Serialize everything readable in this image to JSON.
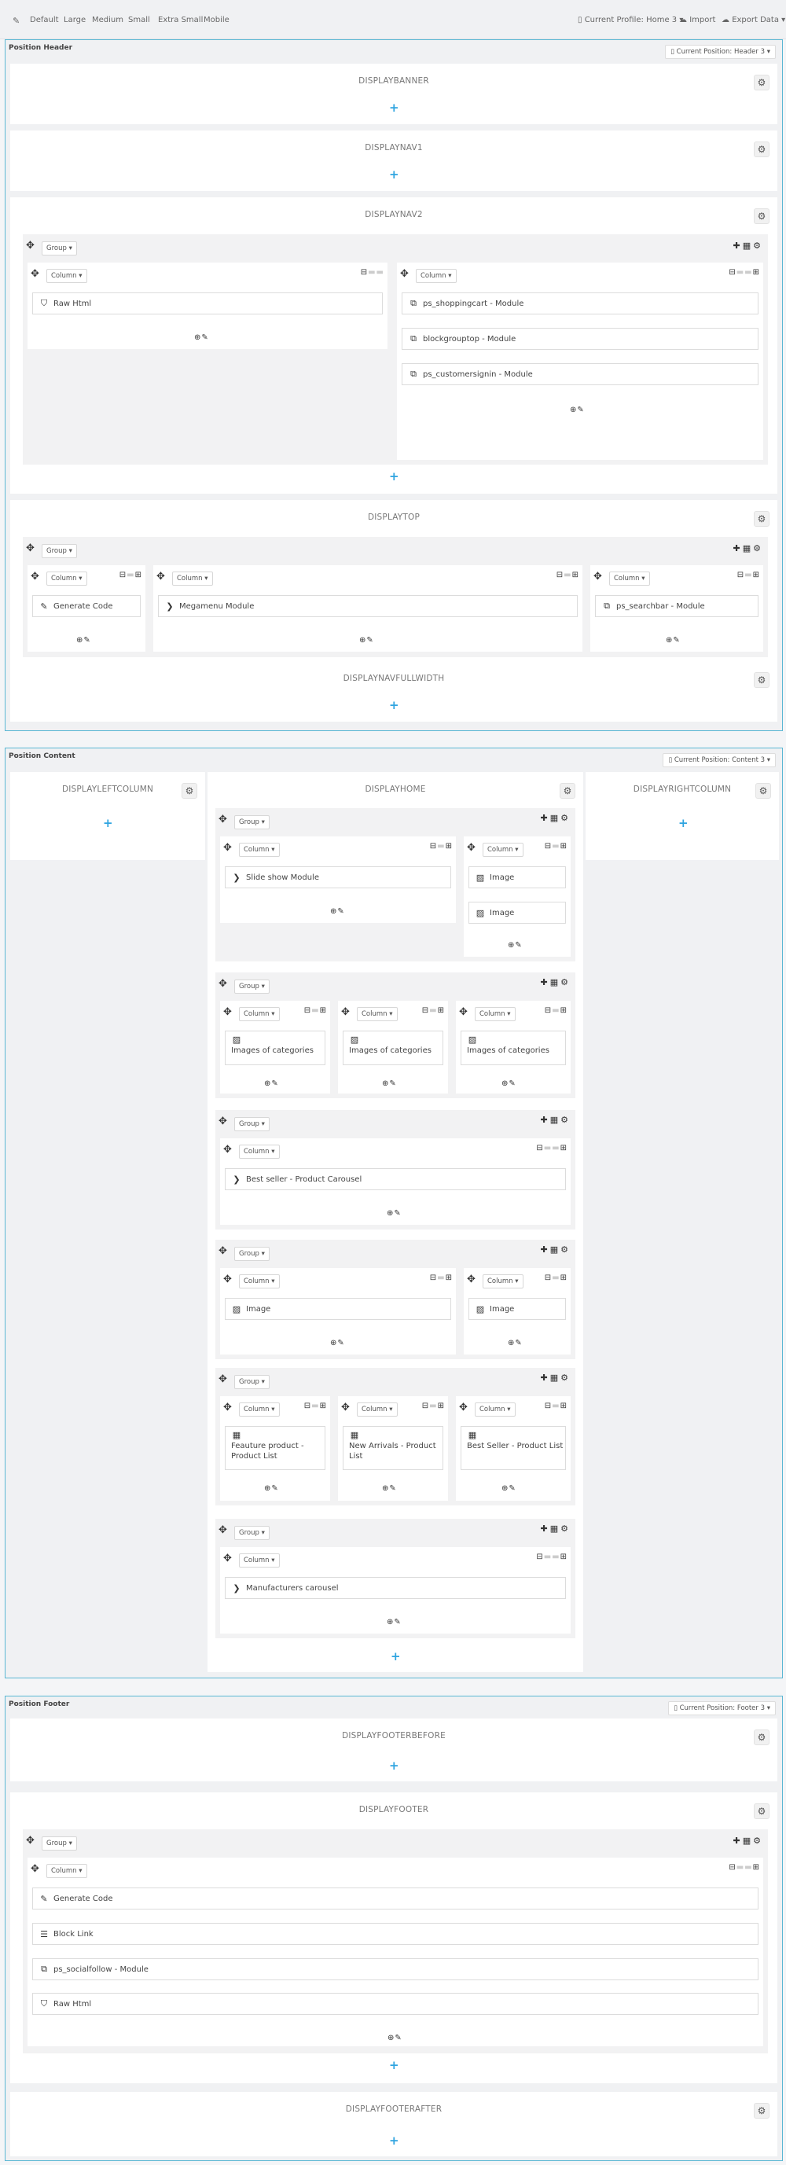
{
  "toolbar": {
    "tool_icon": "wand-icon",
    "devices": [
      "Default",
      "Large",
      "Medium",
      "Small",
      "Extra Small",
      "Mobile"
    ],
    "profile": "Current Profile: Home 3 ▾",
    "import": "Import",
    "export": "Export Data ▾"
  },
  "positions": {
    "header": {
      "title": "Position Header",
      "current": "Current Position: Header 3 ▾"
    },
    "content": {
      "title": "Position Content",
      "current": "Current Position: Content 3 ▾"
    },
    "footer": {
      "title": "Position Footer",
      "current": "Current Position: Footer 3 ▾"
    }
  },
  "hooks": {
    "displaybanner": "DISPLAYBANNER",
    "displaynav1": "DISPLAYNAV1",
    "displaynav2": "DISPLAYNAV2",
    "displaytop": "DISPLAYTOP",
    "displaynavfullwidth": "DISPLAYNAVFULLWIDTH",
    "displayleftcolumn": "DISPLAYLEFTCOLUMN",
    "displayhome": "DISPLAYHOME",
    "displayrightcolumn": "DISPLAYRIGHTCOLUMN",
    "displayfooterbefore": "DISPLAYFOOTERBEFORE",
    "displayfooter": "DISPLAYFOOTER",
    "displayfooterafter": "DISPLAYFOOTERAFTER"
  },
  "labels": {
    "group": "Group ▾",
    "column": "Column ▾",
    "add": "+"
  },
  "widgets": {
    "raw_html": "Raw Html",
    "shoppingcart": "ps_shoppingcart - Module",
    "blockgrouptop": "blockgrouptop - Module",
    "customersignin": "ps_customersignin - Module",
    "generate_code": "Generate Code",
    "megamenu": "Megamenu Module",
    "searchbar": "ps_searchbar - Module",
    "slideshow": "Slide show Module",
    "image": "Image",
    "images_of_categories": "Images of categories",
    "best_seller_carousel": "Best seller - Product Carousel",
    "feature_product": "Feauture product - Product List",
    "new_arrivals": "New Arrivals - Product List",
    "best_seller_list": "Best Seller - Product List",
    "manufacturers": "Manufacturers carousel",
    "block_link": "Block Link",
    "socialfollow": "ps_socialfollow - Module"
  },
  "colors": {
    "accent": "#2fa4e0",
    "position_border": "#5ab7d4"
  }
}
